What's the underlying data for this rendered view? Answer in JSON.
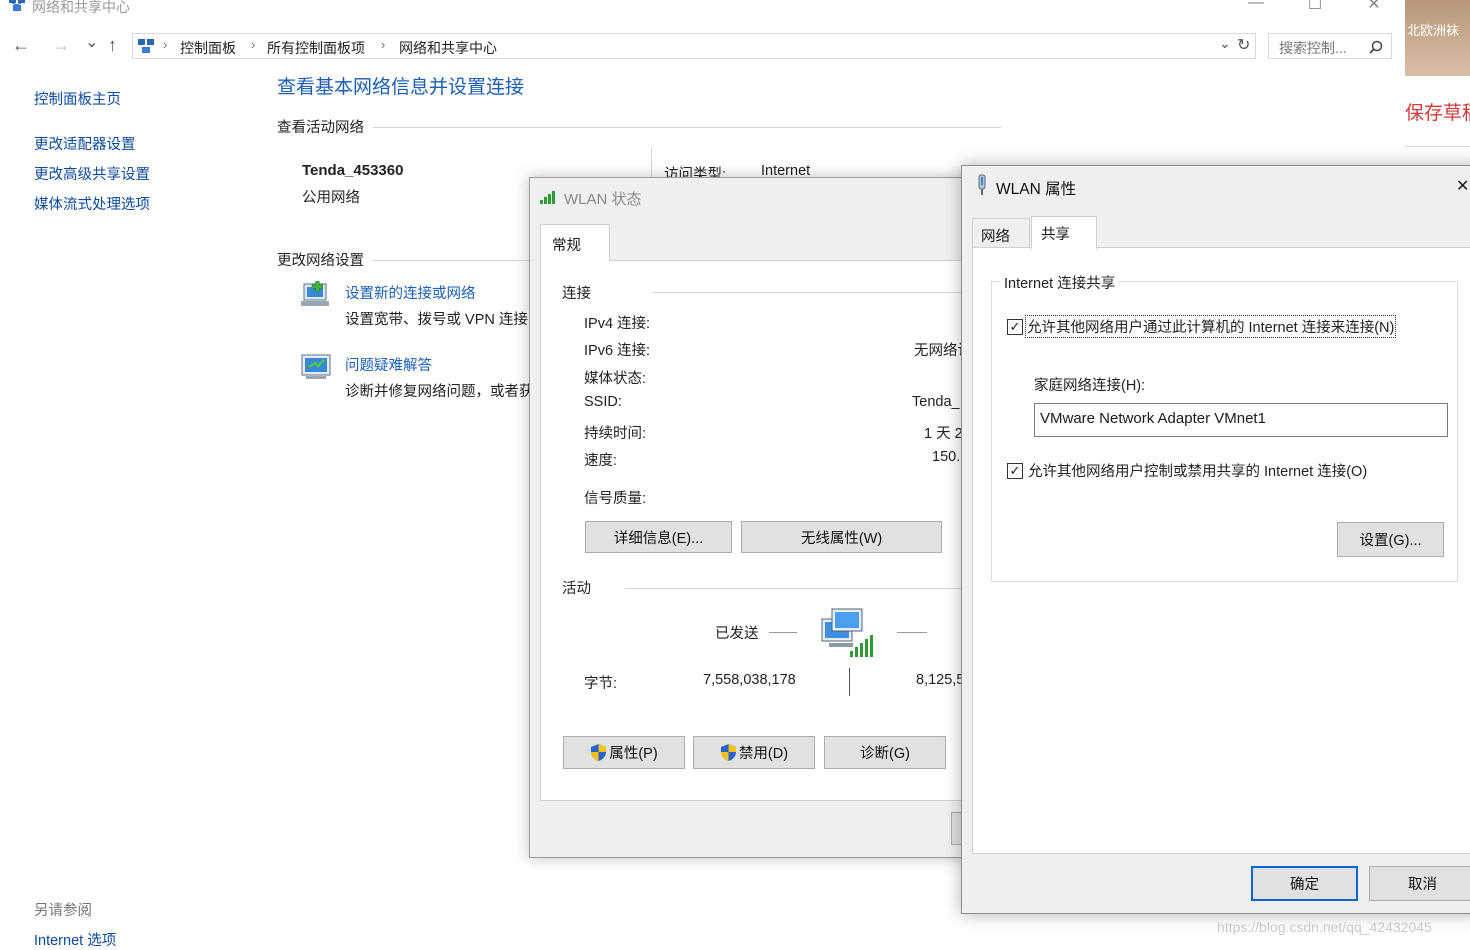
{
  "window": {
    "title": "网络和共享中心",
    "minimize": "—",
    "maximize": "☐",
    "close": "✕"
  },
  "address": {
    "back": "←",
    "forward": "→",
    "down": "⌄",
    "up": "↑",
    "crumbs": [
      "控制面板",
      "所有控制面板项",
      "网络和共享中心"
    ],
    "separator": "›",
    "refresh": "↻",
    "search_placeholder": "搜索控制..."
  },
  "sidebar": {
    "items": [
      "控制面板主页",
      "更改适配器设置",
      "更改高级共享设置",
      "媒体流式处理选项"
    ],
    "see_also_title": "另请参阅",
    "see_also_items": [
      "Internet 选项"
    ]
  },
  "main": {
    "heading": "查看基本网络信息并设置连接",
    "active_networks_title": "查看活动网络",
    "network_name": "Tenda_453360",
    "network_type": "公用网络",
    "access_type_label": "访问类型:",
    "access_type_value": "Internet",
    "change_settings_title": "更改网络设置",
    "tasks": [
      {
        "title": "设置新的连接或网络",
        "desc": "设置宽带、拨号或 VPN 连接"
      },
      {
        "title": "问题疑难解答",
        "desc": "诊断并修复网络问题，或者获"
      }
    ]
  },
  "status_dialog": {
    "title": "WLAN 状态",
    "tab": "常规",
    "connection_section": "连接",
    "rows": [
      {
        "label": "IPv4 连接:",
        "value": ""
      },
      {
        "label": "IPv6 连接:",
        "value": "无网络访"
      },
      {
        "label": "媒体状态:",
        "value": ""
      },
      {
        "label": "SSID:",
        "value": "Tenda_"
      },
      {
        "label": "持续时间:",
        "value": "1 天 2"
      },
      {
        "label": "速度:",
        "value": "150."
      }
    ],
    "signal_label": "信号质量:",
    "details_button": "详细信息(E)...",
    "wireless_button": "无线属性(W)",
    "activity_section": "活动",
    "sent_label": "已发送",
    "bytes_label": "字节:",
    "bytes_sent": "7,558,038,178",
    "bytes_received": "8,125,5",
    "properties_button": "属性(P)",
    "disable_button": "禁用(D)",
    "diagnose_button": "诊断(G)"
  },
  "props_dialog": {
    "title": "WLAN 属性",
    "close": "✕",
    "tabs": [
      "网络",
      "共享"
    ],
    "group_title": "Internet 连接共享",
    "allow_connect": "允许其他网络用户通过此计算机的 Internet 连接来连接(N)",
    "allow_connect_checked": true,
    "home_label": "家庭网络连接(H):",
    "home_value": "VMware Network Adapter VMnet1",
    "allow_control": "允许其他网络用户控制或禁用共享的 Internet 连接(O)",
    "allow_control_checked": true,
    "settings_button": "设置(G)...",
    "ok_button": "确定",
    "cancel_button": "取消"
  },
  "background_right": {
    "top_text": "北欧洲袜",
    "save_text": "保存草稿",
    "watermark": "https://blog.csdn.net/qq_42432045"
  }
}
